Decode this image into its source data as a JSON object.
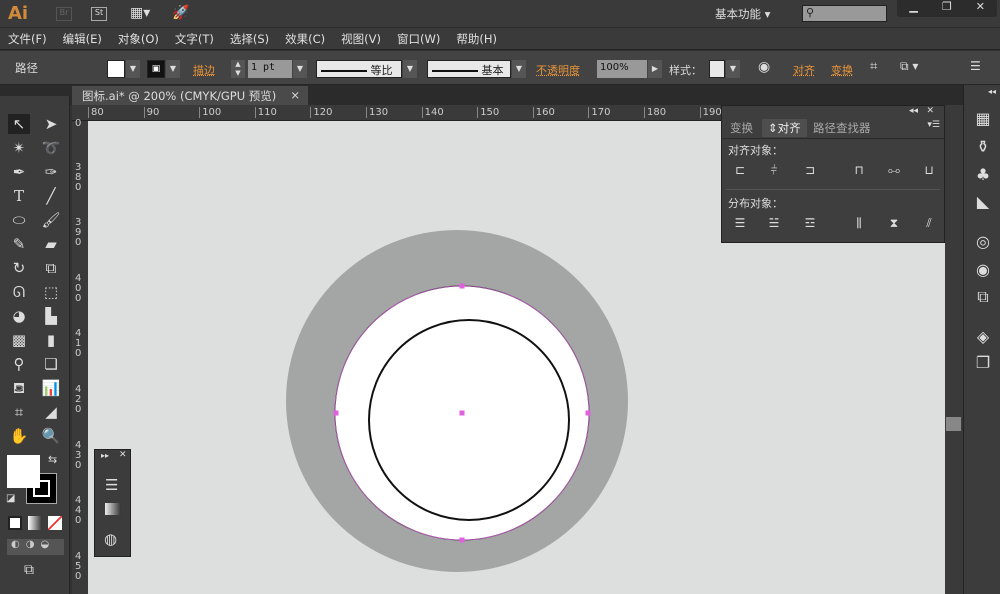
{
  "app": {
    "logo": "Ai",
    "bridge": "Br",
    "stock": "St",
    "workspace": "基本功能",
    "search_placeholder": ""
  },
  "menu": [
    "文件(F)",
    "编辑(E)",
    "对象(O)",
    "文字(T)",
    "选择(S)",
    "效果(C)",
    "视图(V)",
    "窗口(W)",
    "帮助(H)"
  ],
  "control": {
    "selection_type": "路径",
    "stroke_label": "描边",
    "stroke_weight": "1 pt",
    "profile": "等比",
    "brush": "基本",
    "opacity_label": "不透明度",
    "opacity": "100%",
    "style_label": "样式：",
    "align_link": "对齐",
    "transform_link": "变换",
    "fill_color": "#ffffff"
  },
  "document": {
    "tab_title": "图标.ai* @ 200% (CMYK/GPU 预览)",
    "close": "×"
  },
  "ruler": {
    "h": [
      "80",
      "90",
      "100",
      "110",
      "120",
      "130",
      "140",
      "150",
      "160",
      "170",
      "180",
      "190"
    ],
    "v": [
      "0",
      "380",
      "390",
      "400",
      "410",
      "420",
      "430",
      "440",
      "450"
    ]
  },
  "align_panel": {
    "tabs": [
      "变换",
      "对齐",
      "路径查找器"
    ],
    "active_tab": "对齐",
    "align_objects": "对齐对象：",
    "distribute_objects": "分布对象："
  },
  "artwork": {
    "outer_color": "#a3a6a4",
    "inner_fill": "#ffffff",
    "stroke": "#111111",
    "anchor_color": "#e060e0"
  }
}
